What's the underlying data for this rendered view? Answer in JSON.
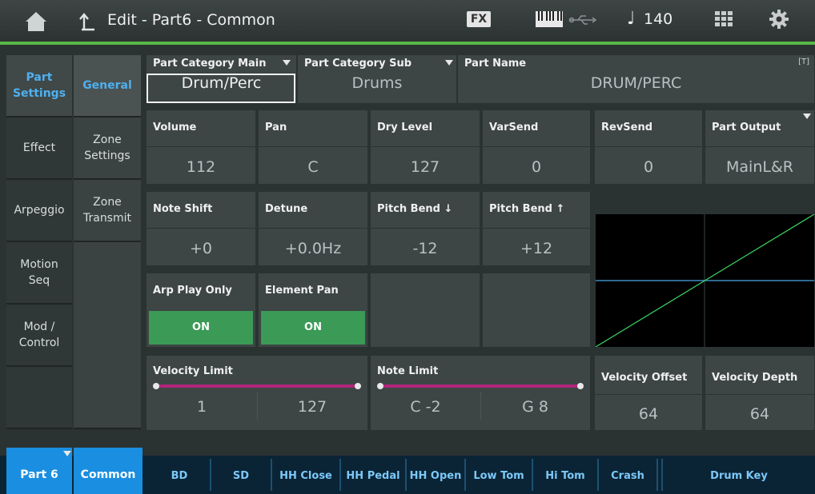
{
  "header": {
    "title": "Edit - Part6 - Common",
    "fx_label": "FX",
    "tempo": "140",
    "note_glyph": "♩",
    "icons": [
      "home-icon",
      "back-icon",
      "piano-keyboard-icon",
      "usb-icon",
      "grid-icon",
      "gear-icon"
    ]
  },
  "left_tabs": [
    {
      "label": "Part\nSettings",
      "active": true
    },
    {
      "label": "Effect",
      "active": false
    },
    {
      "label": "Arpeggio",
      "active": false
    },
    {
      "label": "Motion\nSeq",
      "active": false
    },
    {
      "label": "Mod /\nControl",
      "active": false
    }
  ],
  "sub_tabs": [
    {
      "label": "General",
      "active": true
    },
    {
      "label": "Zone\nSettings",
      "active": false
    },
    {
      "label": "Zone\nTransmit",
      "active": false
    }
  ],
  "category": {
    "main_label": "Part Category Main",
    "main_value": "Drum/Perc",
    "sub_label": "Part Category Sub",
    "sub_value": "Drums",
    "name_label": "Part Name",
    "name_value": "DRUM/PERC",
    "name_badge": "[T]"
  },
  "row1": [
    {
      "label": "Volume",
      "value": "112"
    },
    {
      "label": "Pan",
      "value": "C"
    },
    {
      "label": "Dry Level",
      "value": "127"
    },
    {
      "label": "VarSend",
      "value": "0"
    },
    {
      "label": "RevSend",
      "value": "0"
    },
    {
      "label": "Part Output",
      "value": "MainL&R"
    }
  ],
  "row2": [
    {
      "label": "Note Shift",
      "value": "+0"
    },
    {
      "label": "Detune",
      "value": "+0.0Hz"
    },
    {
      "label": "Pitch Bend ↓",
      "value": "-12"
    },
    {
      "label": "Pitch Bend ↑",
      "value": "+12"
    }
  ],
  "row3": [
    {
      "label": "Arp Play Only",
      "value": "ON"
    },
    {
      "label": "Element Pan",
      "value": "ON"
    }
  ],
  "velocity_limit": {
    "label": "Velocity Limit",
    "low": "1",
    "high": "127"
  },
  "note_limit": {
    "label": "Note Limit",
    "low": "C -2",
    "high": "G 8"
  },
  "velocity_offset": {
    "label": "Velocity Offset",
    "value": "64"
  },
  "velocity_depth": {
    "label": "Velocity Depth",
    "value": "64"
  },
  "bottom": {
    "part": "Part 6",
    "common": "Common",
    "keys": [
      "BD",
      "SD",
      "HH Close",
      "HH Pedal",
      "HH Open",
      "Low Tom",
      "Hi Tom",
      "Crash",
      "Drum Key"
    ]
  },
  "colors": {
    "accent_blue": "#1a8ee0",
    "on_green": "#3a9a56",
    "range_magenta": "#b0257a",
    "graph_green": "#3cd860",
    "graph_blue": "#4aa8e8"
  }
}
